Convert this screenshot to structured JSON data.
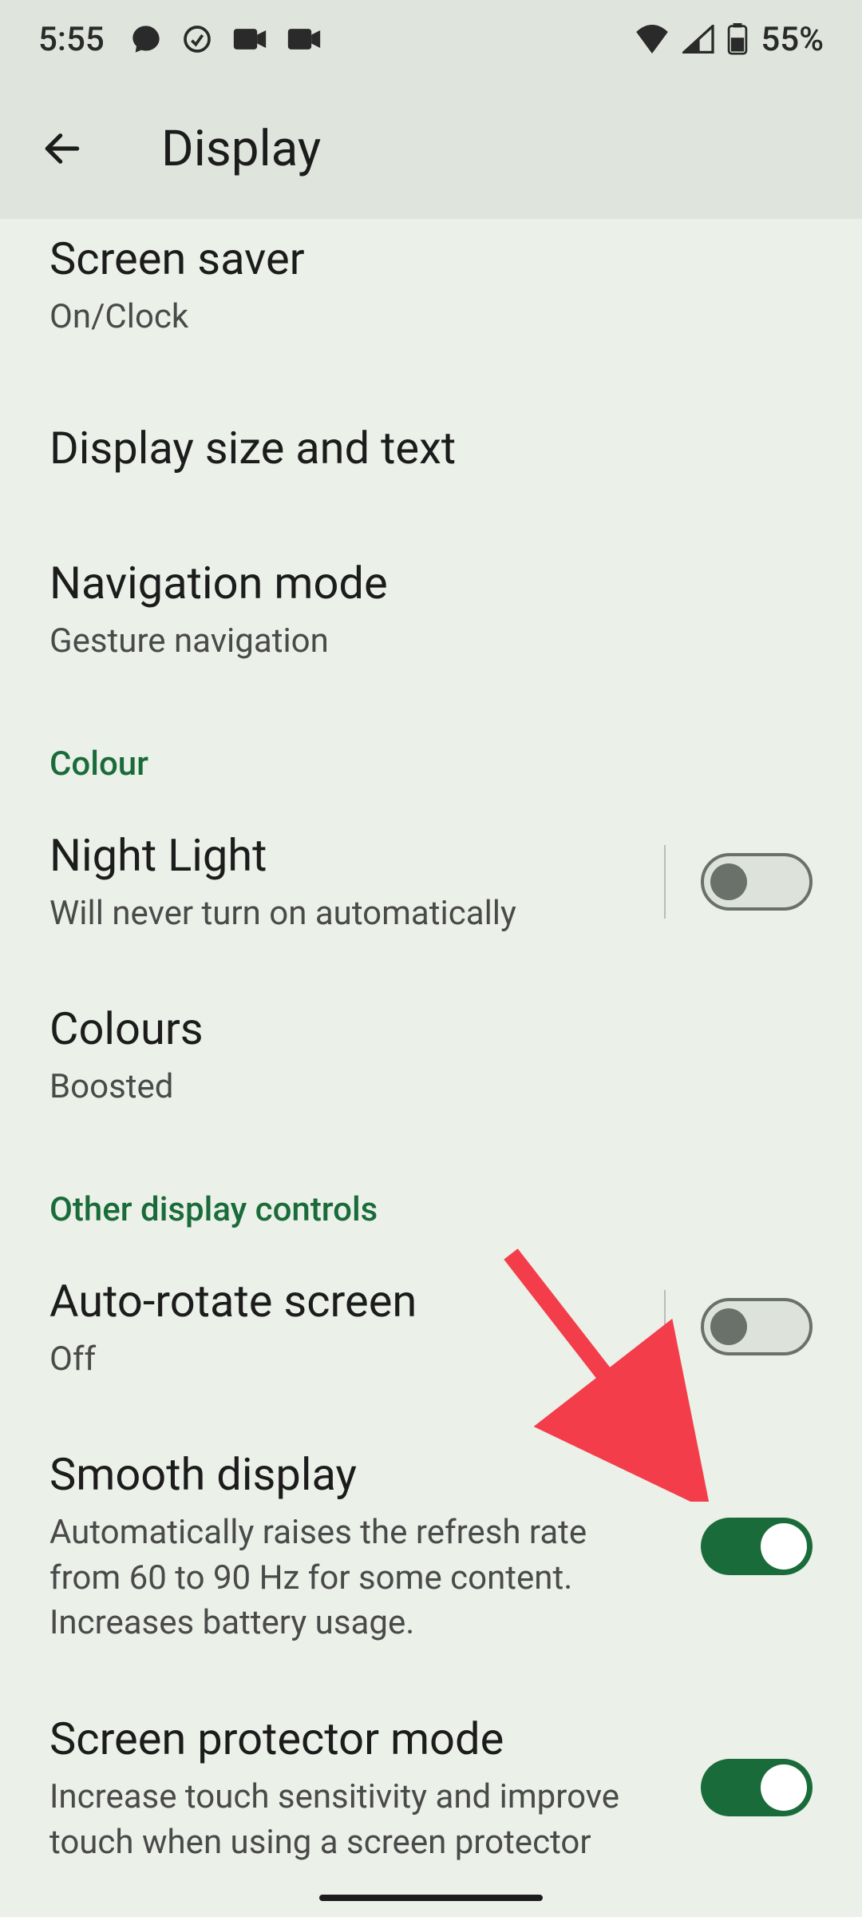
{
  "status": {
    "time": "5:55",
    "battery": "55%"
  },
  "header": {
    "title": "Display"
  },
  "items": {
    "screensaver": {
      "title": "Screen saver",
      "subtitle": "On/Clock"
    },
    "displaySize": {
      "title": "Display size and text"
    },
    "navMode": {
      "title": "Navigation mode",
      "subtitle": "Gesture navigation"
    },
    "nightLight": {
      "title": "Night Light",
      "subtitle": "Will never turn on automatically"
    },
    "colours": {
      "title": "Colours",
      "subtitle": "Boosted"
    },
    "autoRotate": {
      "title": "Auto-rotate screen",
      "subtitle": "Off"
    },
    "smooth": {
      "title": "Smooth display",
      "desc": "Automatically raises the refresh rate from 60 to 90 Hz for some content. Increases battery usage."
    },
    "protector": {
      "title": "Screen protector mode",
      "desc": "Increase touch sensitivity and improve touch when using a screen protector"
    }
  },
  "sections": {
    "colour": "Colour",
    "other": "Other display controls"
  }
}
